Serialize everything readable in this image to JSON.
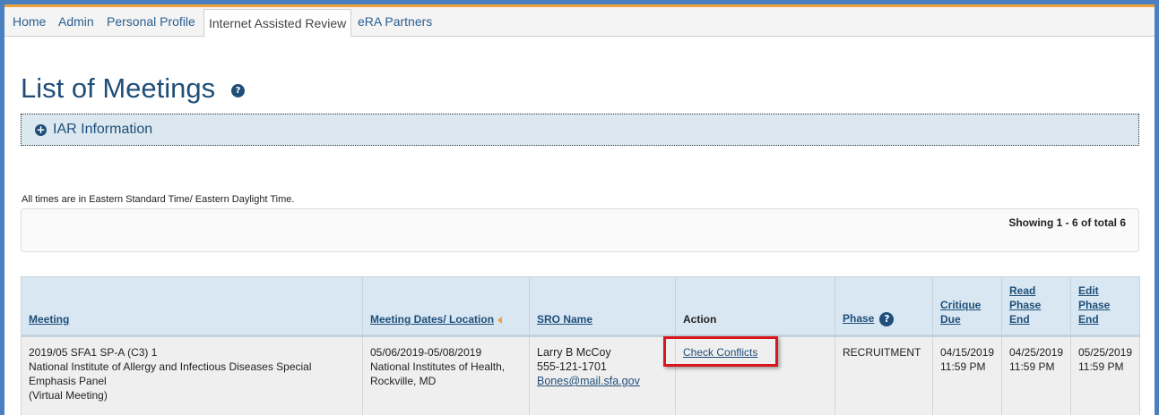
{
  "nav": {
    "items": [
      {
        "label": "Home"
      },
      {
        "label": "Admin"
      },
      {
        "label": "Personal Profile"
      },
      {
        "label": "Internet Assisted Review"
      },
      {
        "label": "eRA Partners"
      }
    ],
    "active": "Internet Assisted Review"
  },
  "page": {
    "title": "List of Meetings",
    "help_glyph": "?"
  },
  "iar_panel": {
    "icon": "plus-circle-icon",
    "icon_glyph": "+",
    "label": "IAR Information"
  },
  "timezone_note": "All times are in Eastern Standard Time/ Eastern Daylight Time.",
  "pagination": {
    "showing": "Showing 1 - 6 of total 6"
  },
  "table": {
    "headers": {
      "meeting": "Meeting",
      "dates_location": "Meeting Dates/ Location",
      "sro_name": "SRO Name",
      "action": "Action",
      "phase": "Phase",
      "critique_due": [
        "Critique",
        "Due"
      ],
      "read_phase_end": [
        "Read",
        "Phase",
        "End"
      ],
      "edit_phase_end": [
        "Edit",
        "Phase",
        "End"
      ]
    },
    "rows": [
      {
        "meeting_code": "2019/05 SFA1 SP-A (C3) 1",
        "meeting_name": "National Institute of Allergy and Infectious Diseases Special Emphasis Panel",
        "meeting_type": "(Virtual Meeting)",
        "dates": "05/06/2019-05/08/2019",
        "location": "National Institutes of Health, Rockville, MD",
        "sro_name": "Larry B McCoy",
        "sro_phone": "555-121-1701",
        "sro_email": "Bones@mail.sfa.gov",
        "action": "Check Conflicts",
        "phase": "RECRUITMENT",
        "critique_due": {
          "date": "04/15/2019",
          "time": "11:59 PM"
        },
        "read_phase_end": {
          "date": "04/25/2019",
          "time": "11:59 PM"
        },
        "edit_phase_end": {
          "date": "05/25/2019",
          "time": "11:59 PM"
        }
      }
    ]
  },
  "colors": {
    "brand_blue": "#1f4e79",
    "accent_orange": "#f0a23a",
    "highlight_red": "#d9161d",
    "header_bg": "#d8e7f2"
  }
}
